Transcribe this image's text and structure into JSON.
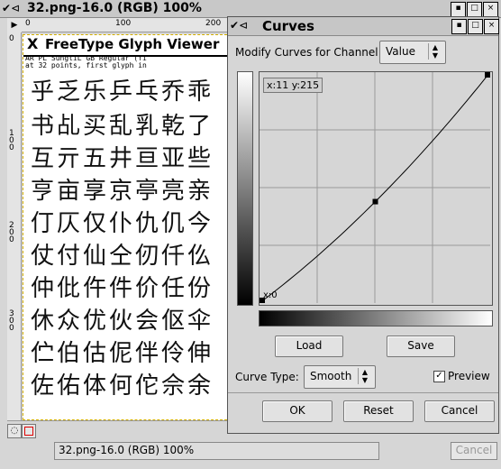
{
  "image_window": {
    "title": "32.png-16.0 (RGB) 100%",
    "ruler_h_ticks": [
      "0",
      "100",
      "200"
    ],
    "ruler_v_ticks": [
      "0",
      "100",
      "200",
      "300"
    ],
    "status": "32.png-16.0 (RGB) 100%",
    "status_cancel": "Cancel"
  },
  "glyph_viewer": {
    "title": "FreeType Glyph Viewer",
    "info_line1": "AR PL SungtiL GB Regular (fi",
    "info_line2": "at 32 points, first glyph in",
    "rows": [
      "乎乏乐乒乓乔乖",
      "书乩买乱乳乾了",
      "互亓五井亘亚些",
      "亨亩享京亭亮亲",
      "仃仄仅仆仇仉今",
      "仗付仙仝仞仟仫",
      "仲仳仵件价任份",
      "休众优伙会伛伞",
      "伫伯估伲伴伶伸",
      "佐佑体何佗佘余"
    ]
  },
  "curves_dialog": {
    "title": "Curves",
    "channel_label": "Modify Curves for Channel:",
    "channel_value": "Value",
    "coord_readout": "x:11 y:215",
    "zero_label": "x:0",
    "load_label": "Load",
    "save_label": "Save",
    "curve_type_label": "Curve Type:",
    "curve_type_value": "Smooth",
    "preview_label": "Preview",
    "preview_checked": true,
    "ok_label": "OK",
    "reset_label": "Reset",
    "cancel_label": "Cancel",
    "control_points": [
      {
        "input": 0,
        "output": 0
      },
      {
        "input": 128,
        "output": 112
      },
      {
        "input": 255,
        "output": 255
      }
    ]
  }
}
